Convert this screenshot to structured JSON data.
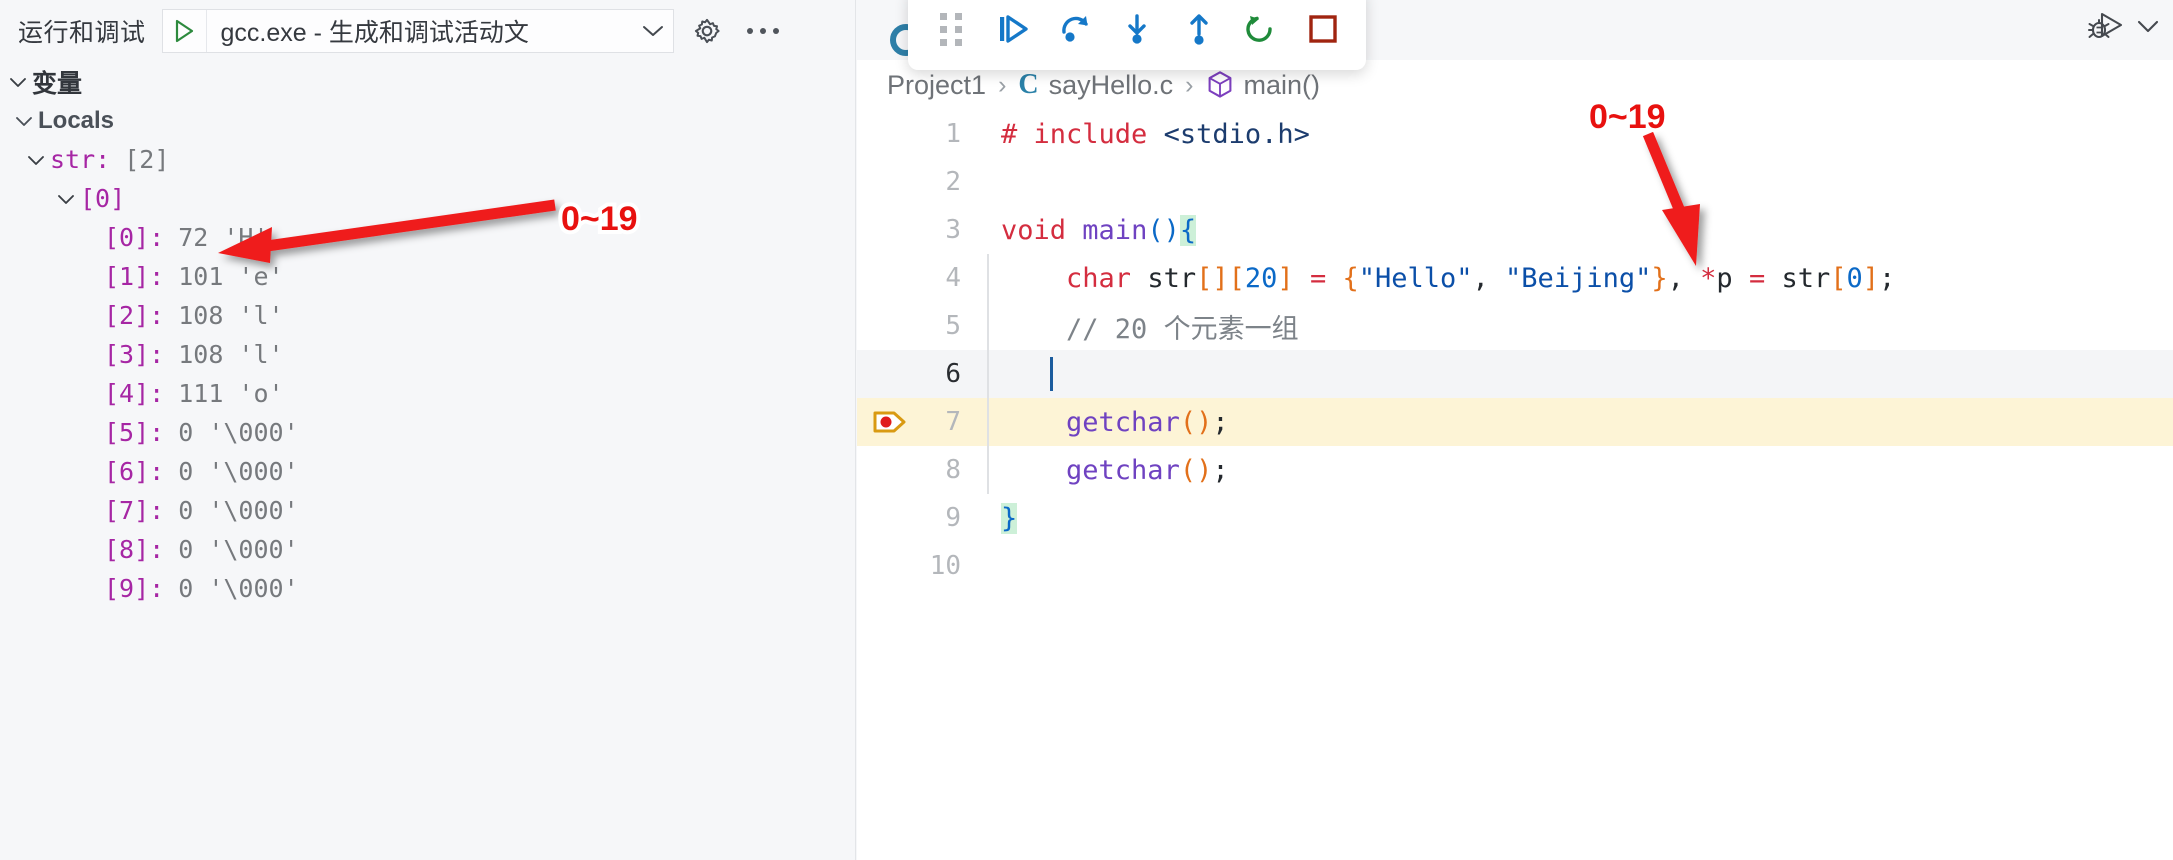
{
  "sidebar": {
    "title": "运行和调试",
    "launch_config": "gcc.exe - 生成和调试活动文",
    "play_icon": "play-triangle-icon",
    "chevron_icon": "chevron-down-icon",
    "gear_icon": "gear-icon",
    "more_icon": "more-horizontal-icon",
    "sections": {
      "variables_label": "变量",
      "locals_label": "Locals"
    },
    "tree": [
      {
        "depth": 0,
        "expanded": true,
        "name": "str:",
        "value": "[2]",
        "type": "object"
      },
      {
        "depth": 1,
        "expanded": true,
        "name": "[0]",
        "value": "",
        "type": "object"
      },
      {
        "depth": 2,
        "expanded": null,
        "name": "[0]:",
        "value": "72 'H'",
        "type": "leaf"
      },
      {
        "depth": 2,
        "expanded": null,
        "name": "[1]:",
        "value": "101 'e'",
        "type": "leaf"
      },
      {
        "depth": 2,
        "expanded": null,
        "name": "[2]:",
        "value": "108 'l'",
        "type": "leaf"
      },
      {
        "depth": 2,
        "expanded": null,
        "name": "[3]:",
        "value": "108 'l'",
        "type": "leaf"
      },
      {
        "depth": 2,
        "expanded": null,
        "name": "[4]:",
        "value": "111 'o'",
        "type": "leaf"
      },
      {
        "depth": 2,
        "expanded": null,
        "name": "[5]:",
        "value": "0 '\\000'",
        "type": "leaf"
      },
      {
        "depth": 2,
        "expanded": null,
        "name": "[6]:",
        "value": "0 '\\000'",
        "type": "leaf"
      },
      {
        "depth": 2,
        "expanded": null,
        "name": "[7]:",
        "value": "0 '\\000'",
        "type": "leaf"
      },
      {
        "depth": 2,
        "expanded": null,
        "name": "[8]:",
        "value": "0 '\\000'",
        "type": "leaf"
      },
      {
        "depth": 2,
        "expanded": null,
        "name": "[9]:",
        "value": "0 '\\000'",
        "type": "leaf"
      }
    ]
  },
  "debug_toolbar": {
    "buttons": [
      {
        "name": "drag-handle-icon",
        "tooltip": ""
      },
      {
        "name": "continue-icon",
        "tooltip": ""
      },
      {
        "name": "step-over-icon",
        "tooltip": ""
      },
      {
        "name": "step-into-icon",
        "tooltip": ""
      },
      {
        "name": "step-out-icon",
        "tooltip": ""
      },
      {
        "name": "restart-icon",
        "tooltip": ""
      },
      {
        "name": "stop-icon",
        "tooltip": ""
      }
    ]
  },
  "topright": {
    "run_debug_icon": "run-and-debug-icon",
    "chevron_icon": "chevron-down-icon"
  },
  "editor": {
    "breadcrumb": [
      {
        "label": "Project1",
        "icon": null
      },
      {
        "label": "sayHello.c",
        "icon": "c-file-icon"
      },
      {
        "label": "main()",
        "icon": "symbol-method-icon"
      }
    ],
    "breadcrumb_separator": "›",
    "lines": [
      {
        "num": "1",
        "state": "normal",
        "breakpoint": false,
        "indent_guide": false
      },
      {
        "num": "2",
        "state": "normal",
        "breakpoint": false,
        "indent_guide": false
      },
      {
        "num": "3",
        "state": "normal",
        "breakpoint": false,
        "indent_guide": false
      },
      {
        "num": "4",
        "state": "normal",
        "breakpoint": false,
        "indent_guide": true
      },
      {
        "num": "5",
        "state": "normal",
        "breakpoint": false,
        "indent_guide": true
      },
      {
        "num": "6",
        "state": "current",
        "breakpoint": false,
        "indent_guide": true
      },
      {
        "num": "7",
        "state": "exec",
        "breakpoint": true,
        "indent_guide": true
      },
      {
        "num": "8",
        "state": "normal",
        "breakpoint": false,
        "indent_guide": true
      },
      {
        "num": "9",
        "state": "normal",
        "breakpoint": false,
        "indent_guide": false
      },
      {
        "num": "10",
        "state": "normal",
        "breakpoint": false,
        "indent_guide": false
      }
    ],
    "source_text": {
      "l1": "# include <stdio.h>",
      "l3": "void main(){",
      "l4": "    char str[][20] = {\"Hello\", \"Beijing\"}, *p = str[0];",
      "l5": "    // 20 个元素一组",
      "l7": "    getchar();",
      "l8": "    getchar();",
      "l9": "}"
    },
    "tokens": {
      "l1_hash": "# include",
      "l1_inc": "<stdio.h>",
      "l3_void": "void",
      "l3_main": "main",
      "l3_paren": "()",
      "l3_brace": "{",
      "l4_char": "char",
      "l4_str": "str",
      "l4_brk1": "[]",
      "l4_brk2o": "[",
      "l4_20": "20",
      "l4_brk2c": "]",
      "l4_eq": "=",
      "l4_obrace": "{",
      "l4_s1": "\"Hello\"",
      "l4_comma1": ", ",
      "l4_s2": "\"Beijing\"",
      "l4_cbrace": "}",
      "l4_comma2": ", ",
      "l4_star": "*",
      "l4_p": "p",
      "l4_eq2": "=",
      "l4_str2": "str",
      "l4_brk3o": "[",
      "l4_zero": "0",
      "l4_brk3c": "]",
      "l4_semi": ";",
      "l5_comment": "// 20 个元素一组",
      "l7_getchar": "getchar",
      "l7_paren": "()",
      "l7_semi": ";",
      "l8_getchar": "getchar",
      "l8_paren": "()",
      "l8_semi": ";",
      "l9_brace": "}"
    },
    "breakpoint_icon": "breakpoint-current-line-icon"
  },
  "annotations": [
    {
      "id": "annot-vars",
      "text": "0~19"
    },
    {
      "id": "annot-editor",
      "text": "0~19"
    }
  ],
  "colors": {
    "annotation_red": "#e8110f",
    "accent_blue": "#0b69c7",
    "keyword_red": "#d42d3f",
    "function_purple": "#6f42c1",
    "bracket_orange": "#e2701a",
    "string_blue": "#0b4fa8",
    "comment_gray": "#7d8389",
    "variable_purple": "#a626a4",
    "exec_line_yellow": "#fdf4d6",
    "restart_green": "#1f8b3a",
    "stop_red": "#a02410"
  }
}
